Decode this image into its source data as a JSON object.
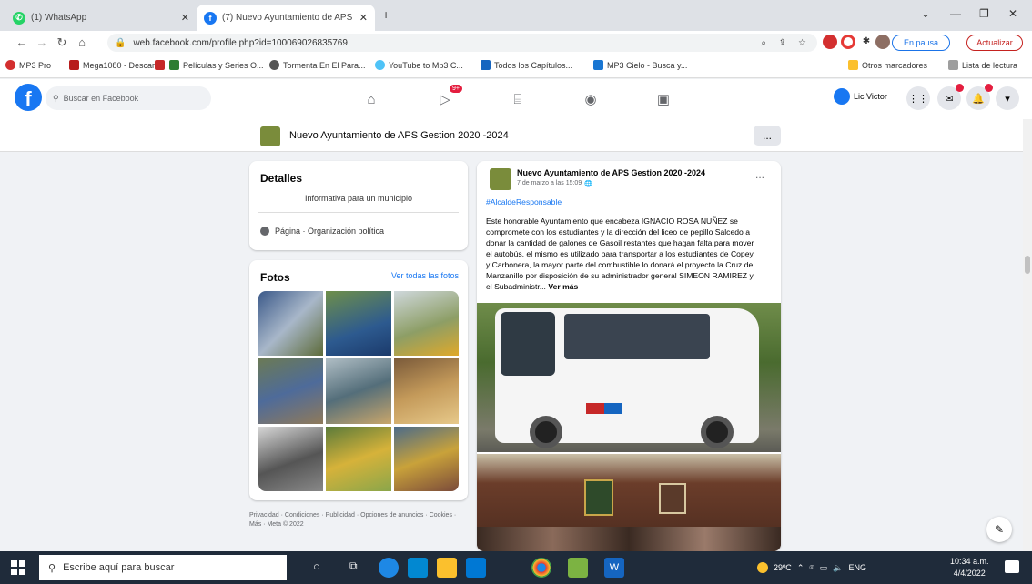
{
  "browser": {
    "tabs": [
      {
        "title": "(1) WhatsApp",
        "active": false
      },
      {
        "title": "(7) Nuevo Ayuntamiento de APS",
        "active": true
      }
    ],
    "url": "web.facebook.com/profile.php?id=100069026835769",
    "profile_label": "En pausa",
    "update_label": "Actualizar"
  },
  "bookmarks": [
    "MP3 Pro",
    "Mega1080 - Descar...",
    "Películas y Series O...",
    "Tormenta En El Para...",
    "YouTube to Mp3 C...",
    "Todos los Capítulos...",
    "MP3 Cielo - Busca y...",
    "Otros marcadores",
    "Lista de lectura"
  ],
  "fb": {
    "search_placeholder": "Buscar en Facebook",
    "video_badge": "9+",
    "user_name": "Lic Victor"
  },
  "page": {
    "name": "Nuevo Ayuntamiento de APS Gestion 2020 -2024",
    "more": "..."
  },
  "details": {
    "title": "Detalles",
    "description": "Informativa para un municipio",
    "category": "Página · Organización política"
  },
  "photos": {
    "title": "Fotos",
    "see_all": "Ver todas las fotos"
  },
  "footer": "Privacidad · Condiciones · Publicidad · Opciones de anuncios · Cookies · Más · Meta © 2022",
  "post": {
    "author": "Nuevo Ayuntamiento de APS Gestion 2020 -2024",
    "time": "7 de marzo a las 15:09",
    "hashtag": "#AlcaldeResponsable",
    "text": "Este honorable Ayuntamiento que encabeza IGNACIO ROSA NUÑEZ se compromete con los estudiantes y la dirección del liceo de pepillo Salcedo a donar la cantidad de galones de Gasoil restantes que hagan falta para mover el autobús, el mismo es utilizado para transportar a los estudiantes de Copey y Carbonera, la mayor parte del combustible lo donará el proyecto la Cruz de Manzanillo por disposición de su administrador general SIMEON RAMIREZ y el Subadministr...",
    "see_more": "Ver más",
    "more": "..."
  },
  "taskbar": {
    "search_placeholder": "Escribe aquí para buscar",
    "weather": "29ºC",
    "lang": "ENG",
    "time": "10:34 a.m.",
    "date": "4/4/2022"
  }
}
